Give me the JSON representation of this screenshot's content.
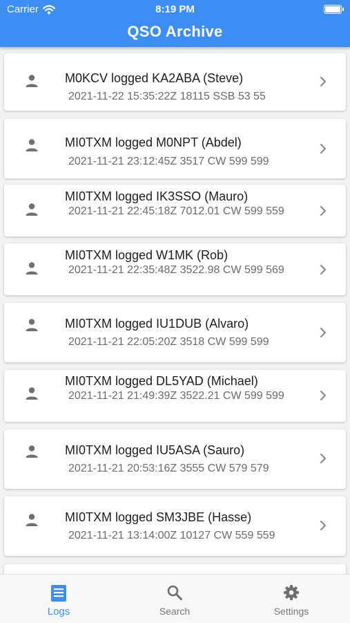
{
  "status": {
    "carrier": "Carrier",
    "time": "8:19 PM"
  },
  "app": {
    "title": "QSO Archive"
  },
  "logs": [
    {
      "title": "M0KCV logged KA2ABA (Steve)",
      "detail": "2021-11-22 15:35:22Z 18115 SSB 53 55"
    },
    {
      "title": "MI0TXM logged M0NPT (Abdel)",
      "detail": "2021-11-21 23:12:45Z 3517 CW 599 599"
    },
    {
      "title": "MI0TXM logged IK3SSO (Mauro)",
      "detail": "2021-11-21 22:45:18Z 7012.01 CW 599 559"
    },
    {
      "title": "MI0TXM logged W1MK (Rob)",
      "detail": "2021-11-21 22:35:48Z 3522.98 CW 599 569"
    },
    {
      "title": "MI0TXM logged IU1DUB (Alvaro)",
      "detail": "2021-11-21 22:05:20Z 3518 CW 599 599"
    },
    {
      "title": "MI0TXM logged DL5YAD (Michael)",
      "detail": "2021-11-21 21:49:39Z 3522.21 CW 599 599"
    },
    {
      "title": "MI0TXM logged IU5ASA (Sauro)",
      "detail": "2021-11-21 20:53:16Z 3555 CW 579 579"
    },
    {
      "title": "MI0TXM logged SM3JBE (Hasse)",
      "detail": "2021-11-21 13:14:00Z 10127 CW 559 559"
    }
  ],
  "tabs": [
    {
      "label": "Logs",
      "icon": "logs-icon",
      "active": true
    },
    {
      "label": "Search",
      "icon": "search-icon",
      "active": false
    },
    {
      "label": "Settings",
      "icon": "gear-icon",
      "active": false
    }
  ],
  "colors": {
    "accent": "#3c8ef5",
    "background": "#f2f2f2",
    "card": "#ffffff",
    "inactive": "#777777"
  }
}
